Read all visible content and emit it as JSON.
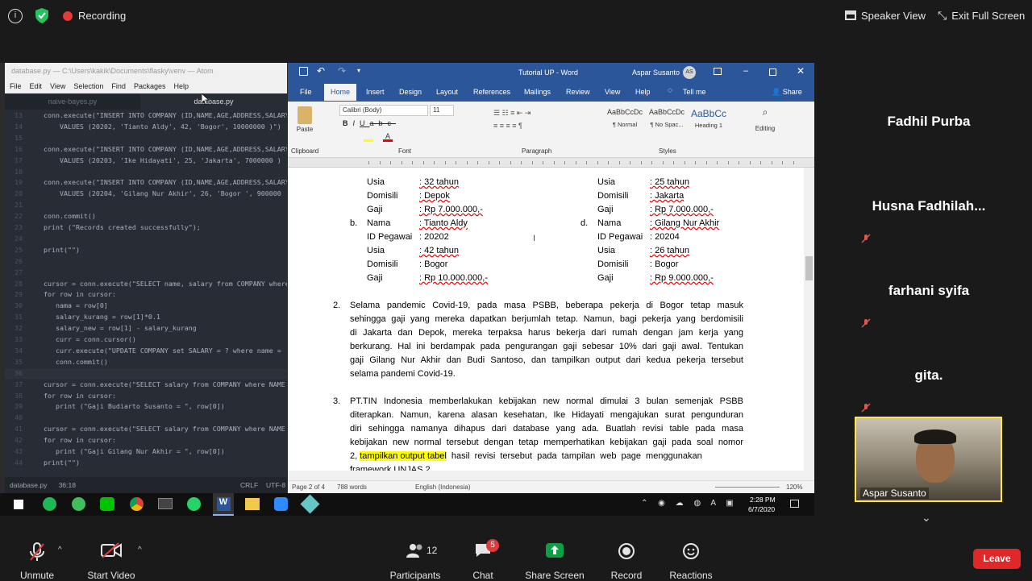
{
  "zoom_top": {
    "recording_label": "Recording",
    "speaker_view": "Speaker View",
    "exit_full_screen": "Exit Full Screen"
  },
  "atom": {
    "title": "database.py — C:\\Users\\kakik\\Documents\\flasky\\venv — Atom",
    "menu": [
      "File",
      "Edit",
      "View",
      "Selection",
      "Find",
      "Packages",
      "Help"
    ],
    "tabs": [
      "naive-bayes.py",
      "database.py"
    ],
    "lines": [
      {
        "n": "13",
        "t": "    conn.execute(\"INSERT INTO COMPANY (ID,NAME,AGE,ADDRESS,SALARY"
      },
      {
        "n": "14",
        "t": "        VALUES (20202, 'Tianto Aldy', 42, 'Bogor', 10000000 )\")"
      },
      {
        "n": "15",
        "t": ""
      },
      {
        "n": "16",
        "t": "    conn.execute(\"INSERT INTO COMPANY (ID,NAME,AGE,ADDRESS,SALARY"
      },
      {
        "n": "17",
        "t": "        VALUES (20203, 'Ike Hidayati', 25, 'Jakarta', 7000000 )"
      },
      {
        "n": "18",
        "t": ""
      },
      {
        "n": "19",
        "t": "    conn.execute(\"INSERT INTO COMPANY (ID,NAME,AGE,ADDRESS,SALARY"
      },
      {
        "n": "20",
        "t": "        VALUES (20204, 'Gilang Nur Akhir', 26, 'Bogor ', 900000"
      },
      {
        "n": "21",
        "t": ""
      },
      {
        "n": "22",
        "t": "    conn.commit()"
      },
      {
        "n": "23",
        "t": "    print (\"Records created successfully\");"
      },
      {
        "n": "24",
        "t": ""
      },
      {
        "n": "25",
        "t": "    print(\"\")"
      },
      {
        "n": "26",
        "t": ""
      },
      {
        "n": "27",
        "t": ""
      },
      {
        "n": "28",
        "t": "    cursor = conn.execute(\"SELECT name, salary from COMPANY where"
      },
      {
        "n": "29",
        "t": "    for row in cursor:"
      },
      {
        "n": "30",
        "t": "       nama = row[0]"
      },
      {
        "n": "31",
        "t": "       salary_kurang = row[1]*0.1"
      },
      {
        "n": "32",
        "t": "       salary_new = row[1] - salary_kurang"
      },
      {
        "n": "33",
        "t": "       curr = conn.cursor()"
      },
      {
        "n": "34",
        "t": "       curr.execute(\"UPDATE COMPANY set SALARY = ? where name ="
      },
      {
        "n": "35",
        "t": "       conn.commit()"
      },
      {
        "n": "36",
        "t": ""
      },
      {
        "n": "37",
        "t": "    cursor = conn.execute(\"SELECT salary from COMPANY where NAME"
      },
      {
        "n": "38",
        "t": "    for row in cursor:"
      },
      {
        "n": "39",
        "t": "       print (\"Gaji Budiarto Susanto = \", row[0])"
      },
      {
        "n": "40",
        "t": ""
      },
      {
        "n": "41",
        "t": "    cursor = conn.execute(\"SELECT salary from COMPANY where NAME"
      },
      {
        "n": "42",
        "t": "    for row in cursor:"
      },
      {
        "n": "43",
        "t": "       print (\"Gaji Gilang Nur Akhir = \", row[0])"
      },
      {
        "n": "44",
        "t": "    print(\"\")"
      }
    ],
    "status_file": "database.py",
    "status_pos": "36:18",
    "status_crlf": "CRLF",
    "status_enc": "UTF-8"
  },
  "word": {
    "title": "Tutorial UP - Word",
    "user": "Aspar Susanto",
    "user_initials": "AS",
    "tabs": [
      "File",
      "Home",
      "Insert",
      "Design",
      "Layout",
      "References",
      "Mailings",
      "Review",
      "View",
      "Help",
      "Tell me"
    ],
    "share": "Share",
    "font_name": "Calibri (Body)",
    "font_size": "11",
    "groups": [
      "Clipboard",
      "Font",
      "Paragraph",
      "Styles"
    ],
    "paste": "Paste",
    "editing": "Editing",
    "styles": [
      {
        "sample": "AaBbCcDc",
        "name": "¶ Normal"
      },
      {
        "sample": "AaBbCcDc",
        "name": "¶ No Spac..."
      },
      {
        "sample": "AaBbCc",
        "name": "Heading 1"
      }
    ],
    "doc": {
      "left_block": [
        [
          "Usia",
          ": 32 tahun"
        ],
        [
          "Domisili",
          ": Depok"
        ],
        [
          "Gaji",
          ": Rp 7.000.000,-"
        ]
      ],
      "b_label": "b.",
      "b_block": [
        [
          "Nama",
          ": Tianto Aldy"
        ],
        [
          "ID Pegawai",
          ": 20202"
        ],
        [
          "Usia",
          ": 42 tahun"
        ],
        [
          "Domisili",
          ": Bogor"
        ],
        [
          "Gaji",
          ": Rp 10.000.000,-"
        ]
      ],
      "right_block": [
        [
          "Usia",
          ": 25 tahun"
        ],
        [
          "Domisili",
          ": Jakarta"
        ],
        [
          "Gaji",
          ": Rp 7.000.000,-"
        ]
      ],
      "d_label": "d.",
      "d_block": [
        [
          "Nama",
          ": Gilang Nur Akhir"
        ],
        [
          "ID Pegawai",
          ": 20204"
        ],
        [
          "Usia",
          ": 26 tahun"
        ],
        [
          "Domisili",
          ": Bogor"
        ],
        [
          "Gaji",
          ": Rp 9.000.000,-"
        ]
      ],
      "p2_num": "2.",
      "p2_lines": [
        "Selama pandemic Covid-19, pada masa PSBB, beberapa pekerja di Bogor tetap masuk",
        "sehingga gaji yang mereka dapatkan berjumlah tetap. Namun, bagi pekerja yang berdomisili",
        "di Jakarta dan Depok, mereka terpaksa harus bekerja dari rumah dengan jam kerja yang",
        "berkurang. Hal ini berdampak pada pengurangan gaji sebesar 10% dari gaji awal. Tentukan",
        "gaji Gilang Nur Akhir dan Budi Santoso, dan tampilkan output dari kedua pekerja tersebut",
        "selama pandemi Covid-19."
      ],
      "p3_num": "3.",
      "p3_lines": [
        "PT.TIN Indonesia memberlakukan kebijakan new normal dimulai 3 bulan semenjak PSBB",
        "diterapkan. Namun, karena alasan kesehatan,  Ike Hidayati mengajukan surat pengunduran",
        "diri sehingga namanya dihapus dari database yang ada. Buatlah revisi table pada masa",
        "kebijakan new normal tersebut dengan tetap memperhatikan kebijakan gaji pada soal nomor"
      ],
      "p3_last_a": "2, ",
      "p3_last_hl": "tampilkan output tabel",
      "p3_last_b": " hasil revisi tersebut pada tampilan web page menggunakan",
      "p3_cut": "framework UNJAS 2"
    },
    "status_page": "Page 2 of 4",
    "status_words": "788 words",
    "status_lang": "English (Indonesia)",
    "status_zoom": "120%"
  },
  "taskbar": {
    "time": "2:28 PM",
    "date": "6/7/2020"
  },
  "participants": [
    {
      "name": "Fadhil Purba",
      "muted": false
    },
    {
      "name": "Husna  Fadhilah...",
      "muted": true
    },
    {
      "name": "farhani syifa",
      "muted": true
    },
    {
      "name": "gita.",
      "muted": true
    }
  ],
  "video_name": "Aspar Susanto",
  "zoom_bottom": {
    "unmute": "Unmute",
    "start_video": "Start Video",
    "participants": "Participants",
    "participants_count": "12",
    "chat": "Chat",
    "chat_badge": "5",
    "share_screen": "Share Screen",
    "record": "Record",
    "reactions": "Reactions",
    "leave": "Leave"
  },
  "colors": {
    "word_blue": "#2b579a",
    "share_green": "#0e9e45",
    "leave_red": "#e02828",
    "recording_red": "#e8393a"
  }
}
